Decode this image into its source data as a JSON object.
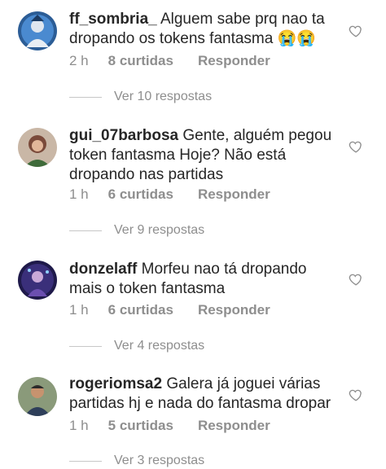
{
  "comments": [
    {
      "username": "ff_sombria_",
      "text": "Alguem sabe prq nao ta dropando os tokens fantasma 😭😭",
      "time": "2 h",
      "likes": "8 curtidas",
      "reply": "Responder",
      "view_replies": "Ver 10 respostas",
      "avatar_color": "#3b6fa8"
    },
    {
      "username": "gui_07barbosa",
      "text": "Gente, alguém pegou token fantasma Hoje? Não está dropando nas partidas",
      "time": "1 h",
      "likes": "6 curtidas",
      "reply": "Responder",
      "view_replies": "Ver 9 respostas",
      "avatar_color": "#7a4a3a"
    },
    {
      "username": "donzelaff",
      "text": "Morfeu nao tá dropando mais o token fantasma",
      "time": "1 h",
      "likes": "6 curtidas",
      "reply": "Responder",
      "view_replies": "Ver 4 respostas",
      "avatar_color": "#3a2f7a"
    },
    {
      "username": "rogeriomsa2",
      "text": "Galera já joguei várias partidas hj e nada do fantasma dropar",
      "time": "1 h",
      "likes": "5 curtidas",
      "reply": "Responder",
      "view_replies": "Ver 3 respostas",
      "avatar_color": "#4a5a3a"
    }
  ],
  "icons": {
    "like": "heart-outline-icon"
  },
  "colors": {
    "text": "#262626",
    "muted": "#8e8e8e",
    "divider": "#c7c7c7"
  }
}
